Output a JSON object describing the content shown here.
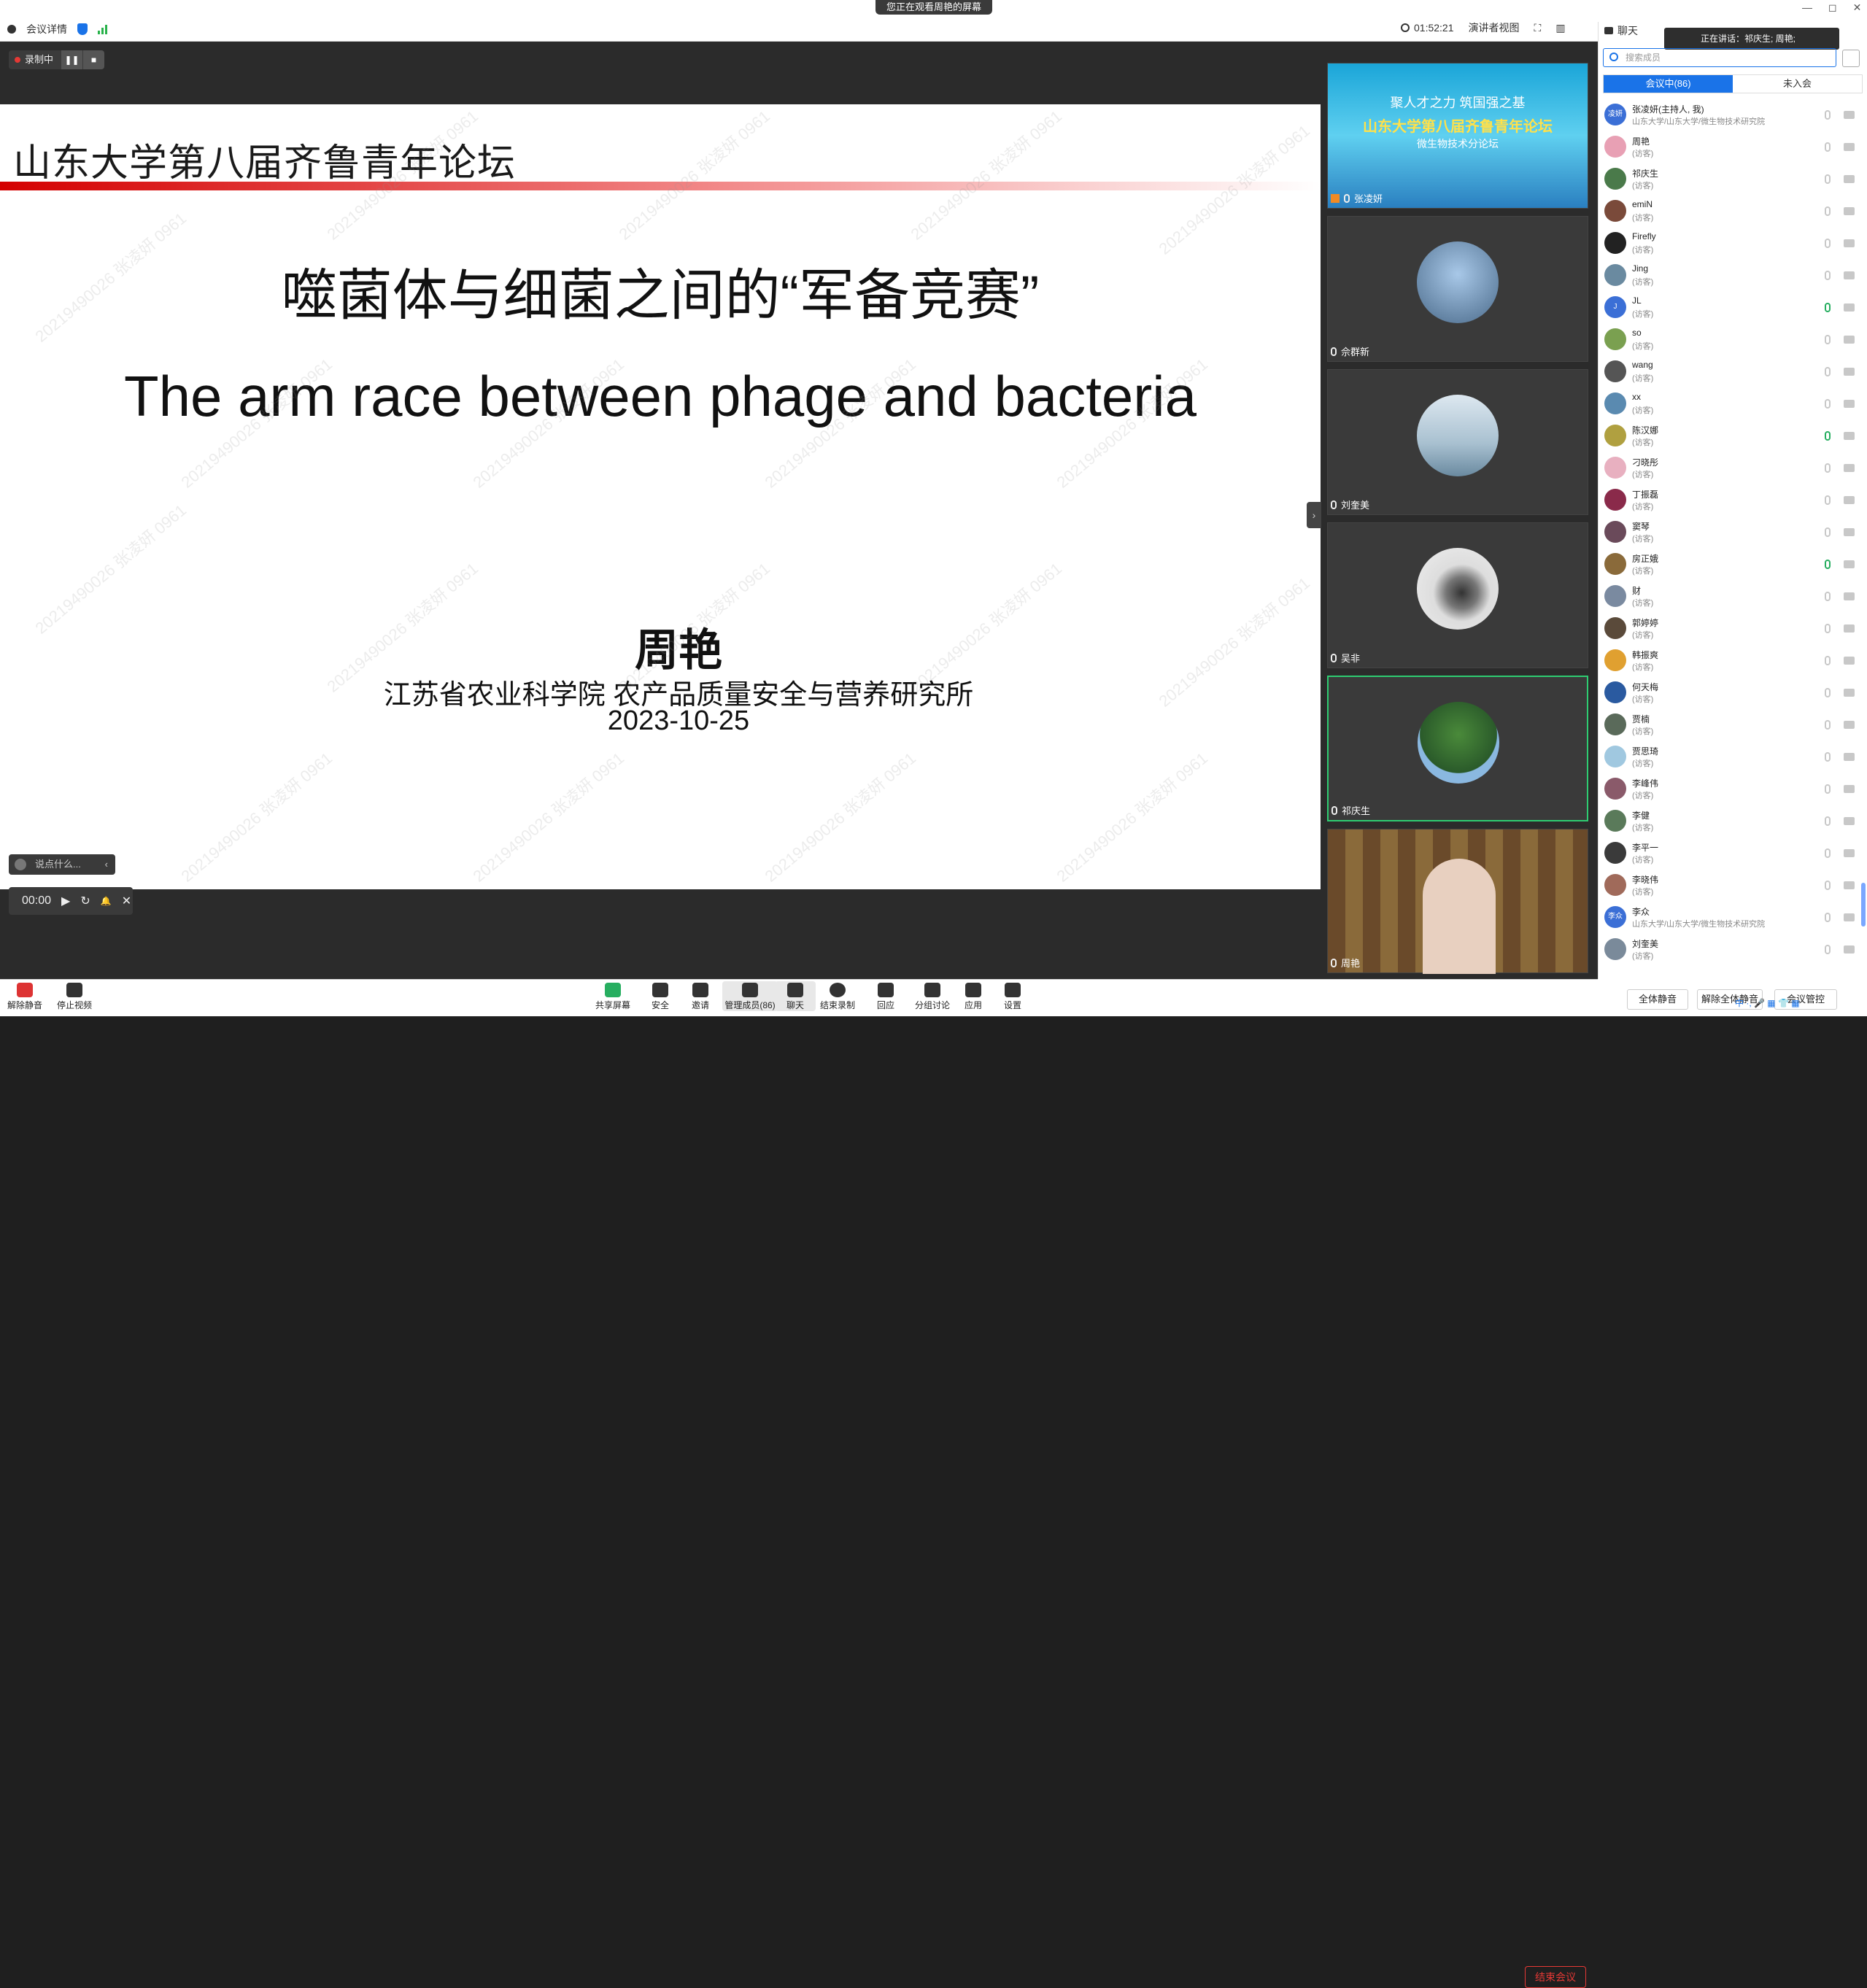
{
  "topbar": {
    "meeting_details": "会议详情",
    "banner": "您正在观看周艳的屏幕",
    "timer": "01:52:21",
    "view_mode": "演讲者视图",
    "window_controls": [
      "—",
      "◻",
      "✕"
    ]
  },
  "recording": {
    "label": "录制中",
    "pause": "❚❚",
    "stop": "■"
  },
  "slide": {
    "header": "山东大学第八届齐鲁青年论坛",
    "title_cn": "噬菌体与细菌之间的“军备竞赛”",
    "title_en": "The arm race between phage and bacteria",
    "speaker": "周艳",
    "affiliation": "江苏省农业科学院 农产品质量安全与营养研究所",
    "date": "2023-10-25",
    "watermark": "20219490026 张凌妍 0961"
  },
  "chat_input": {
    "placeholder": "说点什么...",
    "arrow": "‹"
  },
  "player": {
    "time": "00:00",
    "play": "▶",
    "loop": "↻",
    "bell": "🔔",
    "close": "✕"
  },
  "gallery": {
    "tiles": [
      {
        "name": "张凌妍",
        "poster_line1": "聚人才之力 筑国强之基",
        "poster_line2": "山东大学第八届齐鲁青年论坛",
        "poster_line3": "微生物技术分论坛"
      },
      {
        "name": "佘群新"
      },
      {
        "name": "刘奎美"
      },
      {
        "name": "吴非"
      },
      {
        "name": "祁庆生"
      },
      {
        "name": "周艳"
      }
    ]
  },
  "members_panel": {
    "chat_label": "聊天",
    "speaking_now": "正在讲话：祁庆生; 周艳;",
    "search_placeholder": "搜索成员",
    "tab_in_meeting": "会议中(86)",
    "tab_not_joined": "未入会",
    "members": [
      {
        "name": "张凌妍(主持人, 我)",
        "sub": "山东大学/山东大学/微生物技术研究院",
        "avatar_text": "凌妍",
        "color": "#3b6fd6"
      },
      {
        "name": "周艳",
        "sub": "(访客)",
        "avatar_text": "",
        "color": "#e8a0b4"
      },
      {
        "name": "祁庆生",
        "sub": "(访客)",
        "avatar_text": "",
        "color": "#4a7a4a"
      },
      {
        "name": "emiN",
        "sub": "(访客)",
        "avatar_text": "",
        "color": "#7a4a3a"
      },
      {
        "name": "Firefly",
        "sub": "(访客)",
        "avatar_text": "",
        "color": "#222222"
      },
      {
        "name": "Jing",
        "sub": "(访客)",
        "avatar_text": "",
        "color": "#6a8aa0"
      },
      {
        "name": "JL",
        "sub": "(访客)",
        "avatar_text": "J",
        "color": "#3b6fd6"
      },
      {
        "name": "so",
        "sub": "(访客)",
        "avatar_text": "",
        "color": "#7aa050"
      },
      {
        "name": "wang",
        "sub": "(访客)",
        "avatar_text": "",
        "color": "#555555"
      },
      {
        "name": "xx",
        "sub": "(访客)",
        "avatar_text": "",
        "color": "#5a8ab0"
      },
      {
        "name": "陈汉娜",
        "sub": "(访客)",
        "avatar_text": "",
        "color": "#b0a040"
      },
      {
        "name": "刁晓彤",
        "sub": "(访客)",
        "avatar_text": "",
        "color": "#e8b0c0"
      },
      {
        "name": "丁振磊",
        "sub": "(访客)",
        "avatar_text": "",
        "color": "#8a2a4a"
      },
      {
        "name": "窦琴",
        "sub": "(访客)",
        "avatar_text": "",
        "color": "#6a4a5a"
      },
      {
        "name": "房正娥",
        "sub": "(访客)",
        "avatar_text": "",
        "color": "#8a6a3a"
      },
      {
        "name": "财",
        "sub": "(访客)",
        "avatar_text": "",
        "color": "#7a8aa0"
      },
      {
        "name": "郭婷婷",
        "sub": "(访客)",
        "avatar_text": "",
        "color": "#5a4a3a"
      },
      {
        "name": "韩振爽",
        "sub": "(访客)",
        "avatar_text": "",
        "color": "#e0a030"
      },
      {
        "name": "何天梅",
        "sub": "(访客)",
        "avatar_text": "",
        "color": "#2a5aa0"
      },
      {
        "name": "贾楠",
        "sub": "(访客)",
        "avatar_text": "",
        "color": "#5a6a5a"
      },
      {
        "name": "贾思琦",
        "sub": "(访客)",
        "avatar_text": "",
        "color": "#a0c8e0"
      },
      {
        "name": "李峰伟",
        "sub": "(访客)",
        "avatar_text": "",
        "color": "#8a5a6a"
      },
      {
        "name": "李健",
        "sub": "(访客)",
        "avatar_text": "",
        "color": "#5a7a5a"
      },
      {
        "name": "李平一",
        "sub": "(访客)",
        "avatar_text": "",
        "color": "#3a3a3a"
      },
      {
        "name": "李晓伟",
        "sub": "(访客)",
        "avatar_text": "",
        "color": "#a06a5a"
      },
      {
        "name": "李众",
        "sub": "山东大学/山东大学/微生物技术研究院",
        "avatar_text": "李众",
        "color": "#3b6fd6"
      },
      {
        "name": "刘奎美",
        "sub": "(访客)",
        "avatar_text": "",
        "color": "#7a8a9a"
      }
    ],
    "mute_all": "全体静音",
    "unmute_all": "解除全体静音",
    "more": "会议管控"
  },
  "toolbar": {
    "unmute": "解除静音",
    "stop_video": "停止视频",
    "share_screen": "共享屏幕",
    "security": "安全",
    "invite": "邀请",
    "manage_members": "管理成员(86)",
    "chat": "聊天",
    "end_recording": "结束录制",
    "reactions": "回应",
    "breakout": "分组讨论",
    "apps": "应用",
    "settings": "设置",
    "end_meeting": "结束会议"
  },
  "tray": {
    "text": "中 ·, 🎤 ▦ 👕 ▦"
  },
  "colors": {
    "accent": "#1a73e8",
    "end": "#e53935",
    "active_tile": "#2ecc71",
    "slide_red": "#d40000"
  }
}
